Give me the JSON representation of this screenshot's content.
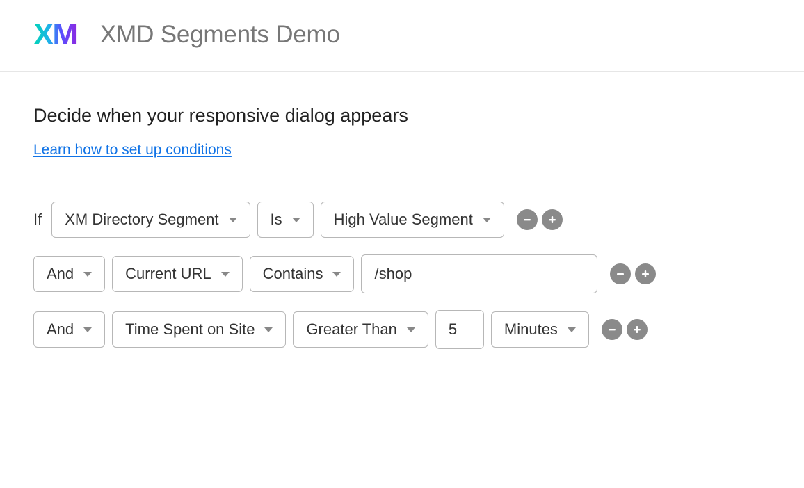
{
  "header": {
    "logo": "XM",
    "title": "XMD Segments Demo"
  },
  "section": {
    "title": "Decide when your responsive dialog appears",
    "help_link": "Learn how to set up conditions"
  },
  "rules": {
    "if_label": "If",
    "row1": {
      "field": "XM Directory Segment",
      "operator": "Is",
      "value": "High Value Segment"
    },
    "row2": {
      "conjunction": "And",
      "field": "Current URL",
      "operator": "Contains",
      "value": "/shop"
    },
    "row3": {
      "conjunction": "And",
      "field": "Time Spent on Site",
      "operator": "Greater Than",
      "value": "5",
      "unit": "Minutes"
    }
  }
}
